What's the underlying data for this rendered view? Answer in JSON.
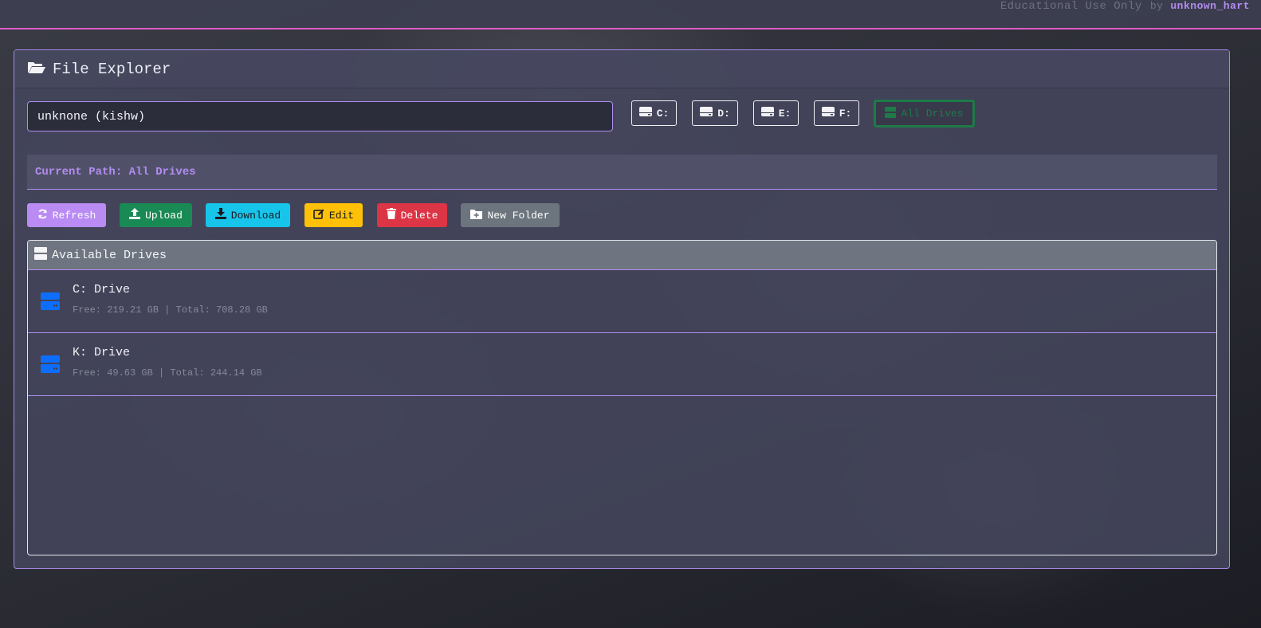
{
  "brand": {
    "text": "Educational Use Only",
    "by": "by",
    "author": "unknown_hart"
  },
  "explorer": {
    "title": "File Explorer",
    "host_value": "unknone (kishw)",
    "drive_buttons": [
      {
        "label": "C:"
      },
      {
        "label": "D:"
      },
      {
        "label": "E:"
      },
      {
        "label": "F:"
      },
      {
        "label": "All Drives"
      }
    ],
    "current_path_label": "Current Path: All Drives",
    "actions": {
      "refresh": "Refresh",
      "upload": "Upload",
      "download": "Download",
      "edit": "Edit",
      "delete": "Delete",
      "new_folder": "New Folder"
    },
    "drives_panel": {
      "title": "Available Drives",
      "drives": [
        {
          "name": "C: Drive",
          "info": "Free: 219.21 GB | Total: 708.28 GB"
        },
        {
          "name": "K: Drive",
          "info": "Free: 49.63 GB | Total: 244.14 GB"
        }
      ]
    }
  },
  "colors": {
    "accent": "#b48cf0",
    "topbar_border": "#e05ac8",
    "drive_icon": "#0d6efd",
    "active_drive": "#1f7a48"
  }
}
